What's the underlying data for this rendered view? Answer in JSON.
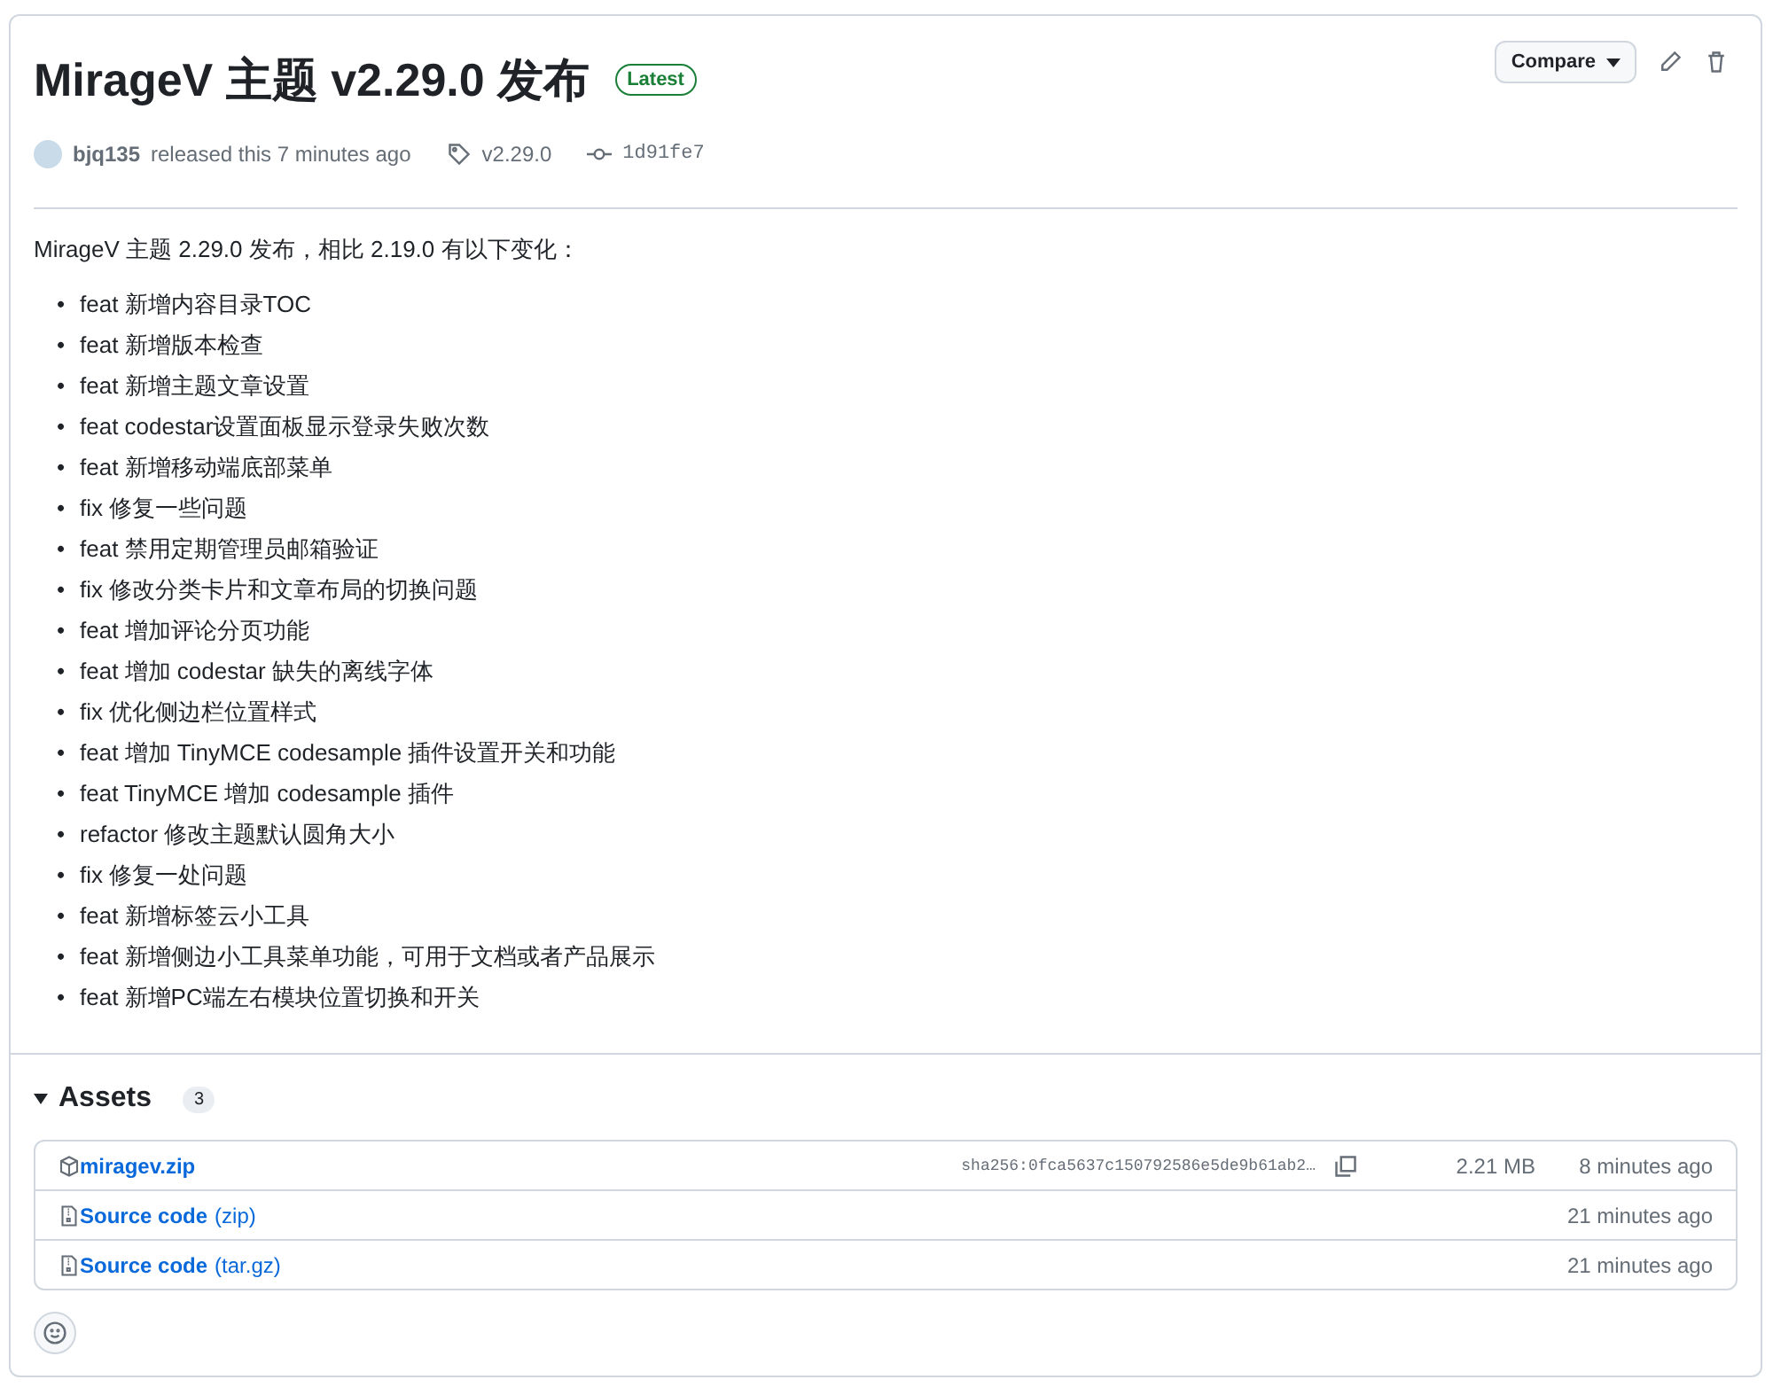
{
  "release": {
    "title": "MirageV 主题 v2.29.0 发布",
    "badge": "Latest",
    "compare_button": "Compare",
    "author": "bjq135",
    "released_text": "released this 7 minutes ago",
    "tag": "v2.29.0",
    "commit": "1d91fe7"
  },
  "notes": {
    "intro": "MirageV 主题 2.29.0 发布，相比 2.19.0 有以下变化：",
    "marker": "•",
    "items": [
      "feat 新增内容目录TOC",
      "feat 新增版本检查",
      "feat 新增主题文章设置",
      "feat codestar设置面板显示登录失败次数",
      "feat 新增移动端底部菜单",
      "fix 修复一些问题",
      "feat 禁用定期管理员邮箱验证",
      "fix 修改分类卡片和文章布局的切换问题",
      "feat 增加评论分页功能",
      "feat 增加 codestar 缺失的离线字体",
      "fix 优化侧边栏位置样式",
      "feat 增加 TinyMCE codesample 插件设置开关和功能",
      "feat TinyMCE 增加 codesample 插件",
      "refactor 修改主题默认圆角大小",
      "fix 修复一处问题",
      "feat 新增标签云小工具",
      "feat 新增侧边小工具菜单功能，可用于文档或者产品展示",
      "feat 新增PC端左右模块位置切换和开关"
    ]
  },
  "assets": {
    "title": "Assets",
    "count": "3",
    "expanded": true,
    "items": [
      {
        "kind": "package",
        "name": "miragev.zip",
        "sha": "sha256:0fca5637c150792586e5de9b61ab2…",
        "size": "2.21 MB",
        "time": "8 minutes ago"
      },
      {
        "kind": "source",
        "name": "Source code",
        "suffix": "(zip)",
        "time": "21 minutes ago"
      },
      {
        "kind": "source",
        "name": "Source code",
        "suffix": "(tar.gz)",
        "time": "21 minutes ago"
      }
    ]
  }
}
